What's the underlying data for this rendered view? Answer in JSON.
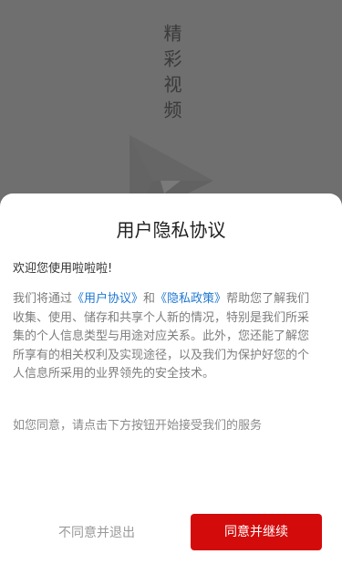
{
  "splash": {
    "title": "精彩视频",
    "logo_icon": "play-triangle-logo-icon"
  },
  "dialog": {
    "title": "用户隐私协议",
    "welcome": "欢迎您使用啦啦啦!",
    "body": {
      "part1": "我们将通过",
      "user_agreement_link": "《用户协议》",
      "part2": "和",
      "privacy_policy_link": "《隐私政策》",
      "part3": "帮助您了解我们收集、使用、储存和共享个人新的情况，特别是我们所采集的个人信息类型与用途对应关系。此外，您还能了解您所享有的相关权利及实现途径，以及我们为保护好您的个人信息所采用的业界领先的安全技术。"
    },
    "consent_note": "如您同意，请点击下方按钮开始接受我们的服务",
    "decline_label": "不同意并退出",
    "agree_label": "同意并继续"
  },
  "colors": {
    "accent": "#d40b0b",
    "link": "#1f78d1",
    "overlay": "#6f6f6f"
  }
}
